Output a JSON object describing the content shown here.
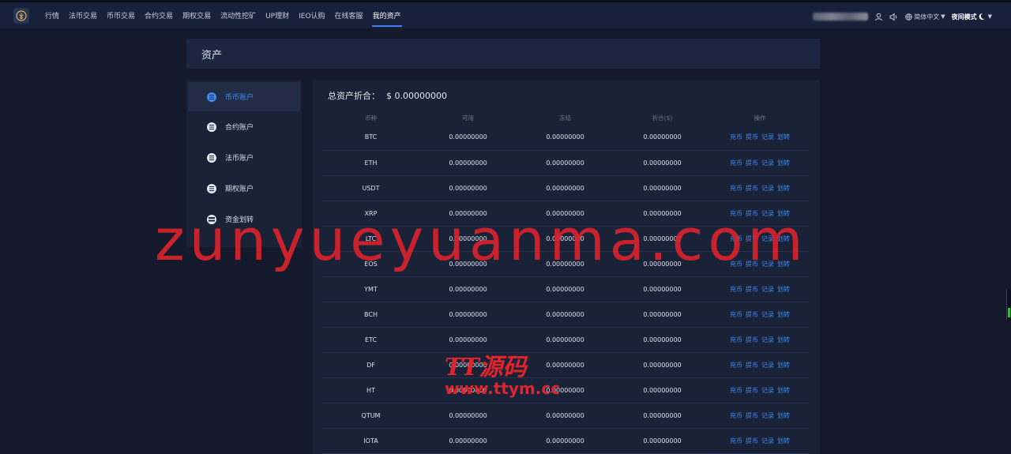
{
  "nav": {
    "items": [
      "行情",
      "法币交易",
      "币币交易",
      "合约交易",
      "期权交易",
      "流动性挖矿",
      "UP理财",
      "IEO认购",
      "在线客服",
      "我的资产"
    ],
    "active_index": 9
  },
  "top_right": {
    "language": "简体中文",
    "night_mode": "夜间模式"
  },
  "page": {
    "title": "资产"
  },
  "sidebar": {
    "items": [
      {
        "label": "币币账户",
        "icon": "coin-account-icon",
        "active": true
      },
      {
        "label": "合约账户",
        "icon": "contract-account-icon",
        "active": false
      },
      {
        "label": "法币账户",
        "icon": "fiat-account-icon",
        "active": false
      },
      {
        "label": "期权账户",
        "icon": "option-account-icon",
        "active": false
      },
      {
        "label": "资金划转",
        "icon": "transfer-icon",
        "active": false
      }
    ]
  },
  "assets": {
    "total_label": "总资产折合：",
    "total_value": "$ 0.00000000",
    "columns": [
      "币种",
      "可用",
      "冻结",
      "折合($)",
      "操作"
    ],
    "actions": [
      "充币",
      "提币",
      "记录",
      "划转"
    ],
    "rows": [
      {
        "coin": "BTC",
        "available": "0.00000000",
        "frozen": "0.00000000",
        "converted": "0.00000000"
      },
      {
        "coin": "ETH",
        "available": "0.00000000",
        "frozen": "0.00000000",
        "converted": "0.00000000"
      },
      {
        "coin": "USDT",
        "available": "0.00000000",
        "frozen": "0.00000000",
        "converted": "0.00000000"
      },
      {
        "coin": "XRP",
        "available": "0.00000000",
        "frozen": "0.00000000",
        "converted": "0.00000000"
      },
      {
        "coin": "LTC",
        "available": "0.00000000",
        "frozen": "0.00000000",
        "converted": "0.00000000"
      },
      {
        "coin": "EOS",
        "available": "0.00000000",
        "frozen": "0.00000000",
        "converted": "0.00000000"
      },
      {
        "coin": "YMT",
        "available": "0.00000000",
        "frozen": "0.00000000",
        "converted": "0.00000000"
      },
      {
        "coin": "BCH",
        "available": "0.00000000",
        "frozen": "0.00000000",
        "converted": "0.00000000"
      },
      {
        "coin": "ETC",
        "available": "0.00000000",
        "frozen": "0.00000000",
        "converted": "0.00000000"
      },
      {
        "coin": "DF",
        "available": "0.00000000",
        "frozen": "0.00000000",
        "converted": "0.00000000"
      },
      {
        "coin": "HT",
        "available": "0.00000000",
        "frozen": "0.00000000",
        "converted": "0.00000000"
      },
      {
        "coin": "QTUM",
        "available": "0.00000000",
        "frozen": "0.00000000",
        "converted": "0.00000000"
      },
      {
        "coin": "IOTA",
        "available": "0.00000000",
        "frozen": "0.00000000",
        "converted": "0.00000000"
      }
    ]
  },
  "watermarks": {
    "main": "zunyueyuanma.com",
    "secondary_line1": "TT源码",
    "secondary_line2": "www.ttym.cc"
  },
  "colors": {
    "accent": "#3d8af7",
    "background": "#141a2b",
    "watermark": "#d9232b"
  }
}
